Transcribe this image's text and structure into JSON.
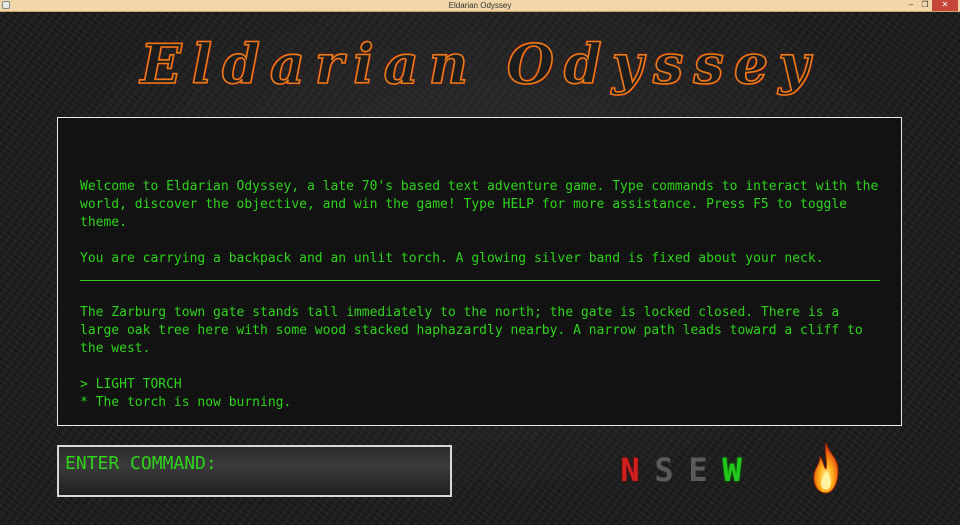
{
  "window": {
    "title": "Eldarian Odyssey"
  },
  "logo": {
    "text": "Eldarian Odyssey"
  },
  "game_text": {
    "welcome": "Welcome to Eldarian Odyssey, a late 70's based text adventure game. Type commands to interact with the world, discover the objective, and win the game! Type HELP for more assistance. Press F5 to toggle theme.",
    "inventory": "You are carrying a backpack and an unlit torch. A glowing silver band is fixed about your neck.",
    "location": "The Zarburg town gate stands tall immediately to the north; the gate is locked closed. There is a large oak tree here with some wood stacked haphazardly nearby. A narrow path leads toward a cliff to the west.",
    "last_command": "> LIGHT TORCH",
    "last_result": "* The torch is now burning."
  },
  "command": {
    "placeholder": "ENTER COMMAND:",
    "value": ""
  },
  "compass": {
    "directions": [
      {
        "label": "N",
        "available": true,
        "color": "#d01f1f"
      },
      {
        "label": "S",
        "available": false,
        "color": "#5a5a5a"
      },
      {
        "label": "E",
        "available": false,
        "color": "#5a5a5a"
      },
      {
        "label": "W",
        "available": true,
        "color": "#22c81c"
      }
    ]
  },
  "status": {
    "torch_icon": "flame-icon",
    "torch_lit": true
  },
  "colors": {
    "terminal_text": "#2fd21d",
    "panel_border": "#e8e8e8",
    "logo_outline": "#e87b1a"
  }
}
